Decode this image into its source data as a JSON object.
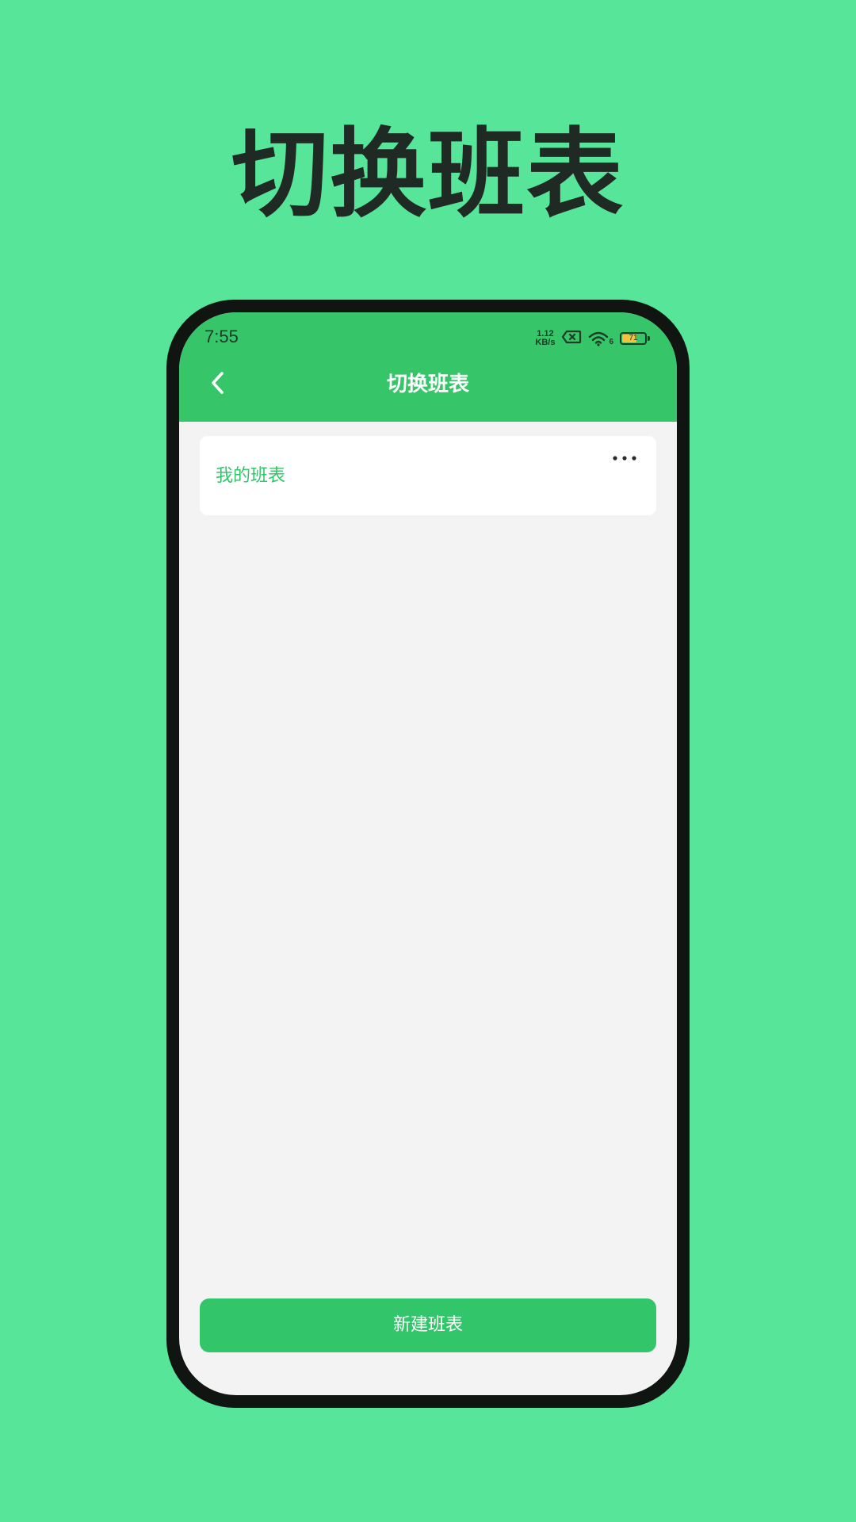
{
  "promo": {
    "headline": "切换班表"
  },
  "status_bar": {
    "time": "7:55",
    "net_speed_value": "1.12",
    "net_speed_unit": "KB/s",
    "wifi_label": "6",
    "battery_level": "71",
    "battery_fraction": 0.71,
    "battery_color": "#f2c33d"
  },
  "header": {
    "title": "切换班表",
    "back_icon": "chevron-left-icon",
    "color": "#36c569"
  },
  "timetables": [
    {
      "name": "我的班表",
      "menu_icon": "more-horizontal-icon"
    }
  ],
  "footer": {
    "new_button_label": "新建班表"
  },
  "colors": {
    "background": "#57e699",
    "accent": "#33c569",
    "text_dark": "#1f2a24"
  }
}
